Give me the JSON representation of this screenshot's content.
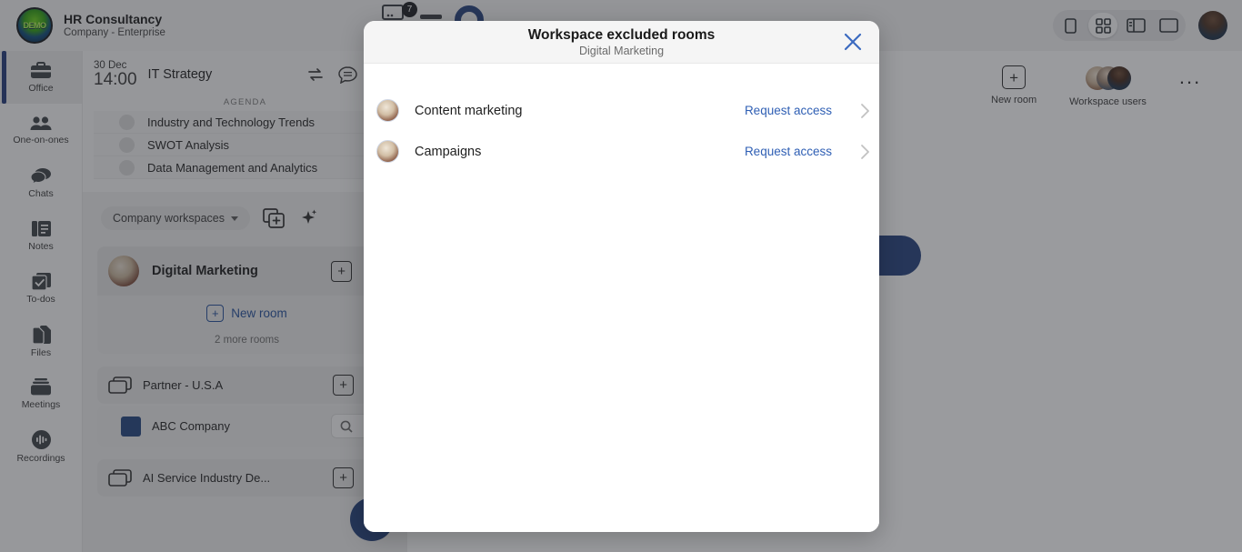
{
  "header": {
    "brand_title": "HR Consultancy",
    "brand_subtitle": "Company - Enterprise",
    "logo_text": "DEMO",
    "notification_badge": "7",
    "view_buttons": [
      {
        "name": "mobile-view",
        "icon": "phone-icon"
      },
      {
        "name": "grid-view",
        "icon": "grid-icon",
        "active": true
      },
      {
        "name": "split-view",
        "icon": "sidebar-panel-icon"
      },
      {
        "name": "full-view",
        "icon": "window-icon"
      }
    ],
    "avatar": "user-avatar"
  },
  "sidebar": {
    "items": [
      {
        "label": "Office",
        "icon": "briefcase-icon",
        "active": true
      },
      {
        "label": "One-on-ones",
        "icon": "people-icon",
        "active": false
      },
      {
        "label": "Chats",
        "icon": "chat-bubbles-icon",
        "active": false
      },
      {
        "label": "Notes",
        "icon": "notes-icon",
        "active": false
      },
      {
        "label": "To-dos",
        "icon": "checkbox-icon",
        "active": false
      },
      {
        "label": "Files",
        "icon": "files-icon",
        "active": false
      },
      {
        "label": "Meetings",
        "icon": "meetings-icon",
        "active": false
      },
      {
        "label": "Recordings",
        "icon": "recordings-icon",
        "active": false
      }
    ]
  },
  "meeting": {
    "date": "30 Dec",
    "time": "14:00",
    "title": "IT Strategy",
    "agenda_label": "AGENDA",
    "agenda_items": [
      {
        "text": "Industry and Technology Trends"
      },
      {
        "text": "SWOT Analysis"
      },
      {
        "text": "Data Management and Analytics"
      }
    ]
  },
  "workspaces": {
    "selector_label": "Company workspaces",
    "digital_marketing": {
      "name": "Digital Marketing",
      "new_room_label": "New room",
      "more_rooms_label": "2 more rooms"
    },
    "folders": [
      {
        "name": "Partner - U.S.A"
      },
      {
        "name": "AI Service Industry De..."
      }
    ],
    "children": [
      {
        "name": "ABC Company"
      }
    ]
  },
  "right_toolbar": {
    "new_room_label": "New room",
    "workspace_users_label": "Workspace users",
    "overflow_label": "..."
  },
  "modal": {
    "title": "Workspace excluded rooms",
    "subtitle": "Digital Marketing",
    "close_label": "✕",
    "rooms": [
      {
        "name": "Content marketing",
        "action": "Request access"
      },
      {
        "name": "Campaigns",
        "action": "Request access"
      }
    ]
  },
  "colors": {
    "accent_blue": "#2f5fb4",
    "brand_navy": "#23407c",
    "modal_header_bg": "#f5f5f5",
    "overlay": "#86888c"
  }
}
